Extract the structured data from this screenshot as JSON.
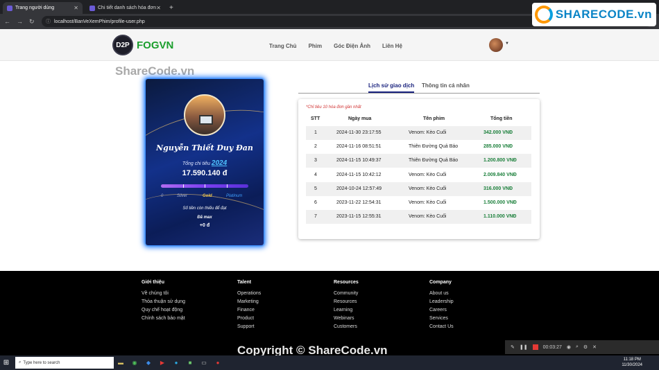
{
  "browser": {
    "tabs": [
      {
        "title": "Trang người dùng"
      },
      {
        "title": "Chi tiết danh sách hóa đơn"
      }
    ],
    "url": "localhost/BanVeXemPhim/profile-user.php"
  },
  "watermark": {
    "logo_text": "SHARECODE.vn",
    "center_text": "ShareCode.vn",
    "copyright": "Copyright © ShareCode.vn"
  },
  "nav": {
    "logo_text": "D2P",
    "brand": "FOGVN",
    "links": [
      "Trang Chủ",
      "Phim",
      "Góc Điện Ảnh",
      "Liên Hệ"
    ]
  },
  "card": {
    "name": "Nguyễn Thiết Duy Đan",
    "spend_label": "Tổng chi tiêu",
    "year": "2024",
    "amount": "17.590.140 đ",
    "progress": 1.0,
    "tiers": [
      "0",
      "Silver",
      "Gold",
      "Platinum"
    ],
    "tier_colors": [
      "#9aa4c8",
      "#b0b8d0",
      "#f1c84a",
      "#3fa0ff"
    ],
    "remaining_label": "Số tiền còn thiếu để đạt",
    "max_label": "Đã max",
    "remaining_amount": "+0 đ"
  },
  "tabs": [
    "Lịch sử giao dịch",
    "Thông tin cá nhân"
  ],
  "history": {
    "note": "*Chỉ tiêu 10 hóa đơn gần nhất",
    "headers": [
      "STT",
      "Ngày mua",
      "Tên phim",
      "Tổng tiền"
    ],
    "rows": [
      [
        "1",
        "2024-11-30 23:17:55",
        "Venom: Kèo Cuối",
        "342.000 VNĐ"
      ],
      [
        "2",
        "2024-11-16 08:51:51",
        "Thiên Đường Quả Báo",
        "285.000 VNĐ"
      ],
      [
        "3",
        "2024-11-15 10:49:37",
        "Thiên Đường Quả Báo",
        "1.200.800 VNĐ"
      ],
      [
        "4",
        "2024-11-15 10:42:12",
        "Venom: Kèo Cuối",
        "2.009.840 VNĐ"
      ],
      [
        "5",
        "2024-10-24 12:57:49",
        "Venom: Kèo Cuối",
        "316.000 VNĐ"
      ],
      [
        "6",
        "2023-11-22 12:54:31",
        "Venom: Kèo Cuối",
        "1.500.000 VNĐ"
      ],
      [
        "7",
        "2023-11-15 12:55:31",
        "Venom: Kèo Cuối",
        "1.110.000 VNĐ"
      ]
    ]
  },
  "footer": {
    "columns": [
      {
        "title": "Giới thiệu",
        "items": [
          "Về chúng tôi",
          "Thỏa thuận sử dụng",
          "Quy chế hoạt động",
          "Chính sách bảo mật"
        ]
      },
      {
        "title": "Talent",
        "items": [
          "Operations",
          "Marketing",
          "Finance",
          "Product",
          "Support"
        ]
      },
      {
        "title": "Resources",
        "items": [
          "Community",
          "Resources",
          "Learning",
          "Webinars",
          "Customers"
        ]
      },
      {
        "title": "Company",
        "items": [
          "About us",
          "Leadership",
          "Careers",
          "Services",
          "Contact Us"
        ]
      }
    ]
  },
  "recorder": {
    "time": "00:03:27"
  },
  "taskbar": {
    "search_placeholder": "Type here to search",
    "time": "11:18 PM",
    "date": "11/30/2024"
  }
}
